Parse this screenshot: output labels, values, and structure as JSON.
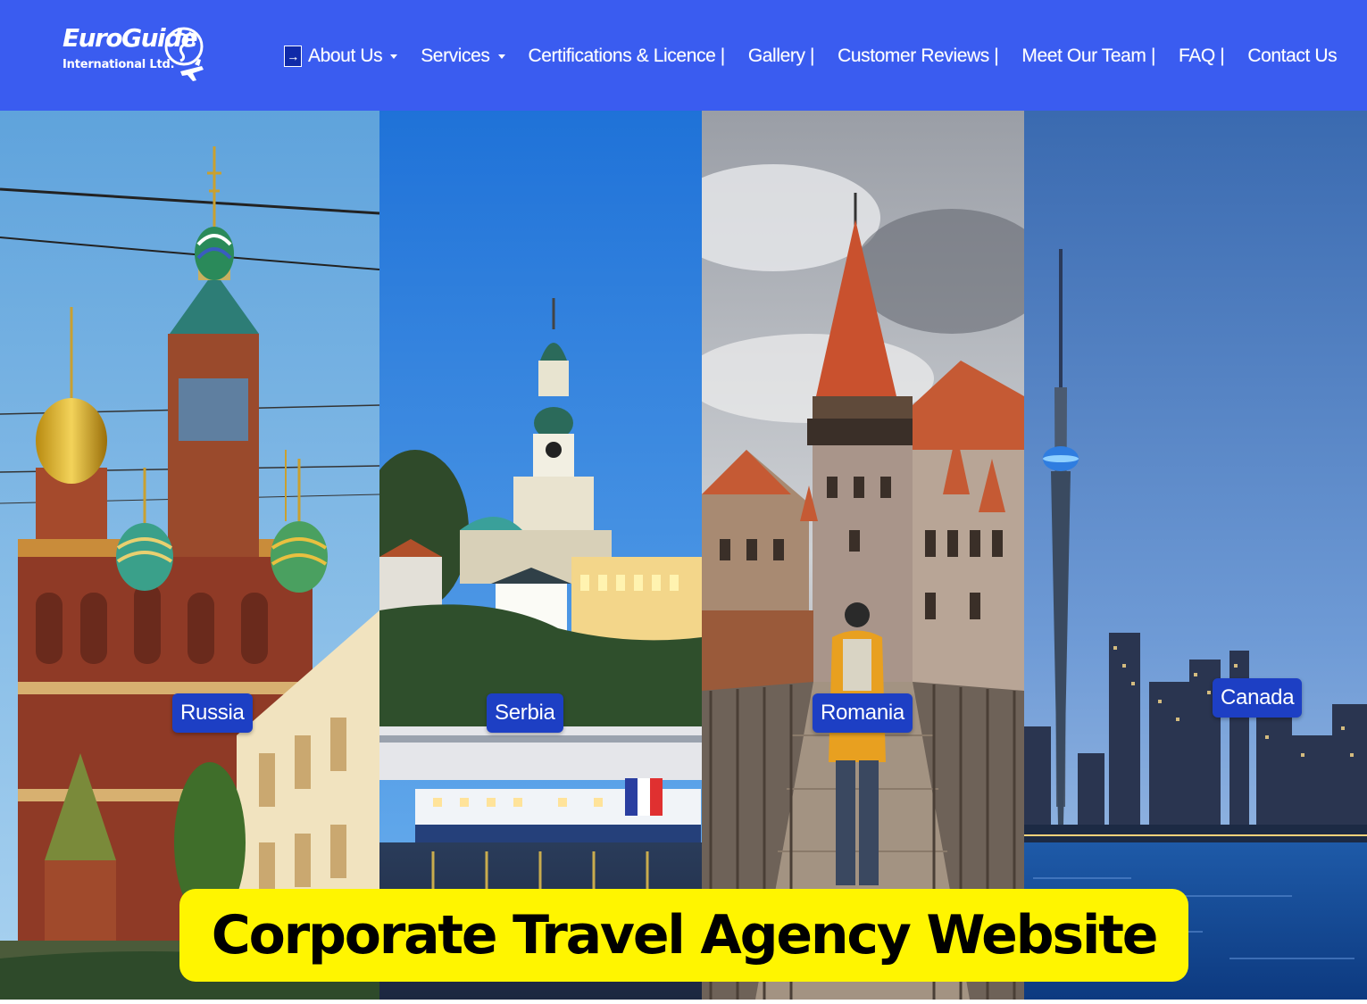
{
  "brand": {
    "name_line1": "EuroGuide",
    "name_line2": "International Ltd."
  },
  "nav": {
    "items": [
      {
        "label": "About Us",
        "dropdown": true,
        "icon": "arrow-right-icon"
      },
      {
        "label": "Services",
        "dropdown": true
      },
      {
        "label": "Certifications & Licence |",
        "dropdown": false
      },
      {
        "label": "Gallery |",
        "dropdown": false
      },
      {
        "label": "Customer Reviews |",
        "dropdown": false
      },
      {
        "label": "Meet Our Team |",
        "dropdown": false
      },
      {
        "label": "FAQ |",
        "dropdown": false
      },
      {
        "label": "Contact Us",
        "dropdown": false
      }
    ]
  },
  "destinations": [
    {
      "label": "Russia"
    },
    {
      "label": "Serbia"
    },
    {
      "label": "Romania"
    },
    {
      "label": "Canada"
    }
  ],
  "banner": {
    "text": "Corporate Travel Agency Website"
  },
  "colors": {
    "nav_background": "#3a5cf0",
    "label_background": "#1d3fc4",
    "banner_background": "#fff500"
  }
}
